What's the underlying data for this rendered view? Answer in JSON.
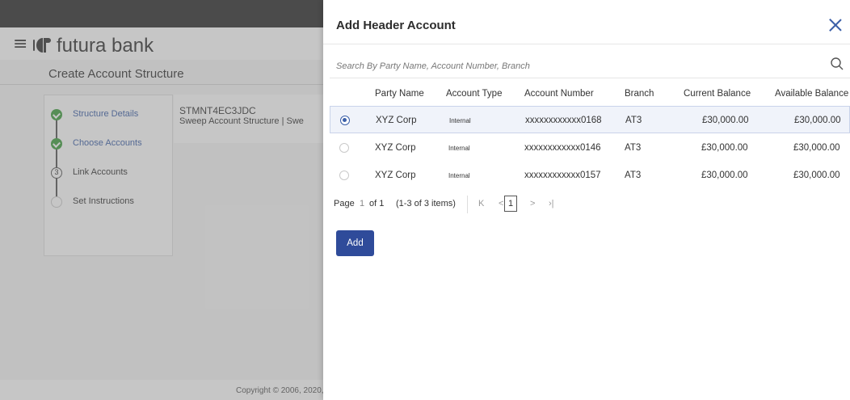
{
  "app": {
    "brand_name": "futura bank",
    "page_title": "Create Account Structure",
    "steps": [
      {
        "label": "Structure Details",
        "state": "done"
      },
      {
        "label": "Choose Accounts",
        "state": "done"
      },
      {
        "label": "Link Accounts",
        "state": "current",
        "number": "3"
      },
      {
        "label": "Set Instructions",
        "state": "pending"
      }
    ],
    "summary": {
      "structure_id": "STMNT4EC3JDC",
      "structure_type": "Sweep Account Structure  |  Swe"
    },
    "footer": "Copyright © 2006, 2020,"
  },
  "modal": {
    "title": "Add Header Account",
    "search_placeholder": "Search By Party Name, Account Number, Branch",
    "columns": [
      "Party Name",
      "Account Type",
      "Account Number",
      "Branch",
      "Current Balance",
      "Available Balance"
    ],
    "rows": [
      {
        "party_name": "XYZ Corp",
        "account_type": "Internal",
        "account_number": "xxxxxxxxxxxx0168",
        "branch": "AT3",
        "current_balance": "£30,000.00",
        "available_balance": "£30,000.00",
        "selected": true
      },
      {
        "party_name": "XYZ Corp",
        "account_type": "Internal",
        "account_number": "xxxxxxxxxxxx0146",
        "branch": "AT3",
        "current_balance": "£30,000.00",
        "available_balance": "£30,000.00",
        "selected": false
      },
      {
        "party_name": "XYZ Corp",
        "account_type": "Internal",
        "account_number": "xxxxxxxxxxxx0157",
        "branch": "AT3",
        "current_balance": "£30,000.00",
        "available_balance": "£30,000.00",
        "selected": false
      }
    ],
    "pagination": {
      "page_label": "Page",
      "page": "1",
      "of_label": "of 1",
      "items_label": "(1-3 of 3 items)",
      "first": "K",
      "prev": "<",
      "current": "1",
      "next": ">",
      "last": "›|"
    },
    "add_button": "Add"
  },
  "colors": {
    "accent": "#3b5fa8",
    "button": "#2f4b9a",
    "step_done": "#3f9f3f",
    "top_bar": "#2b2b2b"
  },
  "icons": [
    "hamburger-icon",
    "futura-logo-icon",
    "close-icon",
    "search-icon",
    "check-icon"
  ]
}
